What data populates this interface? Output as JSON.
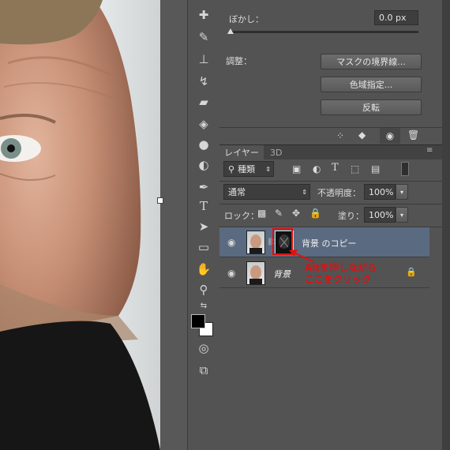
{
  "properties": {
    "feather_label": "ぼかし：",
    "feather_value": "0.0 px",
    "adjust_label": "調整：",
    "buttons": [
      "マスクの境界線...",
      "色域指定...",
      "反転"
    ]
  },
  "layers_panel": {
    "tabs": [
      "レイヤー",
      "3D"
    ],
    "filter_kind": "種類",
    "blend_mode": "通常",
    "opacity_label": "不透明度：",
    "opacity_value": "100%",
    "lock_label": "ロック：",
    "fill_label": "塗り：",
    "fill_value": "100%",
    "layers": [
      {
        "name": "背景 のコピー",
        "selected": true
      },
      {
        "name": "背景",
        "selected": false
      }
    ]
  },
  "annotation": {
    "line1": "Altを押しながら",
    "line2": "ここをクリック",
    "color": "#e01010"
  },
  "icons": [
    "healing-brush-icon",
    "brush-icon",
    "stamp-icon",
    "history-brush-icon",
    "eraser-icon",
    "paint-bucket-icon",
    "blur-icon",
    "dodge-icon",
    "pen-icon",
    "type-icon",
    "path-select-icon",
    "rectangle-icon",
    "hand-icon",
    "zoom-icon",
    "swap-colors-icon",
    "quick-mask-icon",
    "screen-mode-icon"
  ],
  "colors": {
    "panel_bg": "#535353",
    "selected_layer": "#5a6a80",
    "foreground": "#000000",
    "background": "#ffffff"
  }
}
